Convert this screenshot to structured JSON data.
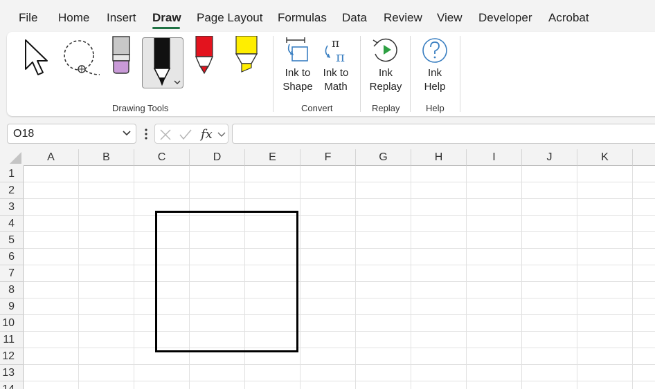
{
  "menu": {
    "tabs": [
      {
        "label": "File"
      },
      {
        "label": "Home"
      },
      {
        "label": "Insert"
      },
      {
        "label": "Draw"
      },
      {
        "label": "Page Layout"
      },
      {
        "label": "Formulas"
      },
      {
        "label": "Data"
      },
      {
        "label": "Review"
      },
      {
        "label": "View"
      },
      {
        "label": "Developer"
      },
      {
        "label": "Acrobat"
      }
    ],
    "active_tab": "Draw",
    "accent_color": "#1f7244"
  },
  "ribbon": {
    "drawing_tools": {
      "group_label": "Drawing Tools",
      "tools": [
        "select-icon",
        "lasso-select-icon",
        "eraser-icon",
        "black-pen-icon",
        "red-pen-icon",
        "yellow-highlighter-icon"
      ],
      "selected_tool": "black-pen-icon"
    },
    "convert": {
      "group_label": "Convert",
      "ink_to_shape": "Ink to\nShape",
      "ink_to_shape_l1": "Ink to",
      "ink_to_shape_l2": "Shape",
      "ink_to_math_l1": "Ink to",
      "ink_to_math_l2": "Math"
    },
    "replay": {
      "group_label": "Replay",
      "ink_replay_l1": "Ink",
      "ink_replay_l2": "Replay"
    },
    "help": {
      "group_label": "Help",
      "ink_help_l1": "Ink",
      "ink_help_l2": "Help"
    }
  },
  "formula_bar": {
    "name_box_value": "O18",
    "formula_value": ""
  },
  "sheet": {
    "columns": [
      "A",
      "B",
      "C",
      "D",
      "E",
      "F",
      "G",
      "H",
      "I",
      "J",
      "K"
    ],
    "rows": [
      "1",
      "2",
      "3",
      "4",
      "5",
      "6",
      "7",
      "8",
      "9",
      "10",
      "11",
      "12",
      "13",
      "14"
    ]
  }
}
